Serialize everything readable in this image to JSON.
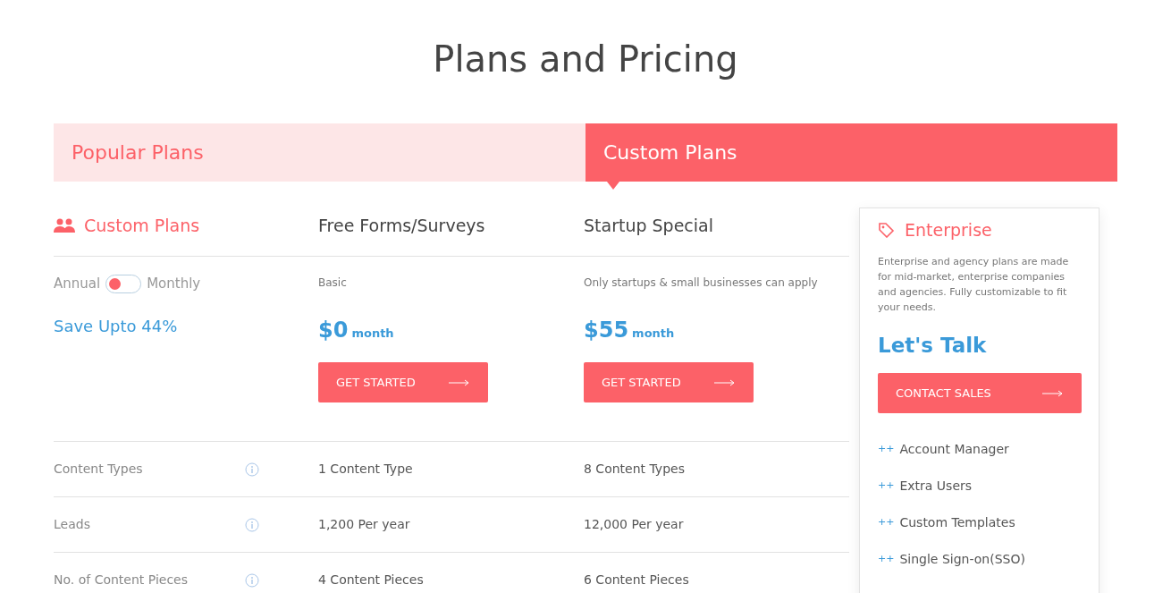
{
  "title": "Plans and Pricing",
  "tabs": [
    {
      "label": "Popular Plans",
      "selected": false
    },
    {
      "label": "Custom Plans",
      "selected": true
    }
  ],
  "side": {
    "heading": "Custom Plans",
    "toggle": {
      "left_label": "Annual",
      "right_label": "Monthly",
      "on": false
    },
    "save": "Save Upto 44%"
  },
  "plans": [
    {
      "name": "Free Forms/Surveys",
      "note": "Basic",
      "price": "$0",
      "period": "month",
      "button": "GET STARTED"
    },
    {
      "name": "Startup Special",
      "note": "Only startups & small businesses can apply",
      "price": "$55",
      "period": "month",
      "button": "GET STARTED"
    }
  ],
  "features": [
    {
      "label": "Content Types",
      "values": [
        "1 Content Type",
        "8 Content Types"
      ]
    },
    {
      "label": "Leads",
      "values": [
        "1,200 Per year",
        "12,000 Per year"
      ]
    },
    {
      "label": "No. of Content Pieces",
      "values": [
        "4 Content Pieces",
        "6 Content Pieces"
      ]
    }
  ],
  "enterprise": {
    "title": "Enterprise",
    "description": "Enterprise and agency plans are made for mid-market, enterprise companies and agencies. Fully customizable to fit your needs.",
    "cta": "Let's Talk",
    "button": "CONTACT SALES",
    "extras": [
      {
        "marker": "++",
        "label": "Account Manager"
      },
      {
        "marker": "++",
        "label": "Extra Users"
      },
      {
        "marker": "++",
        "label": "Custom Templates"
      },
      {
        "marker": "++",
        "label": "Single Sign-on(SSO)"
      }
    ]
  }
}
